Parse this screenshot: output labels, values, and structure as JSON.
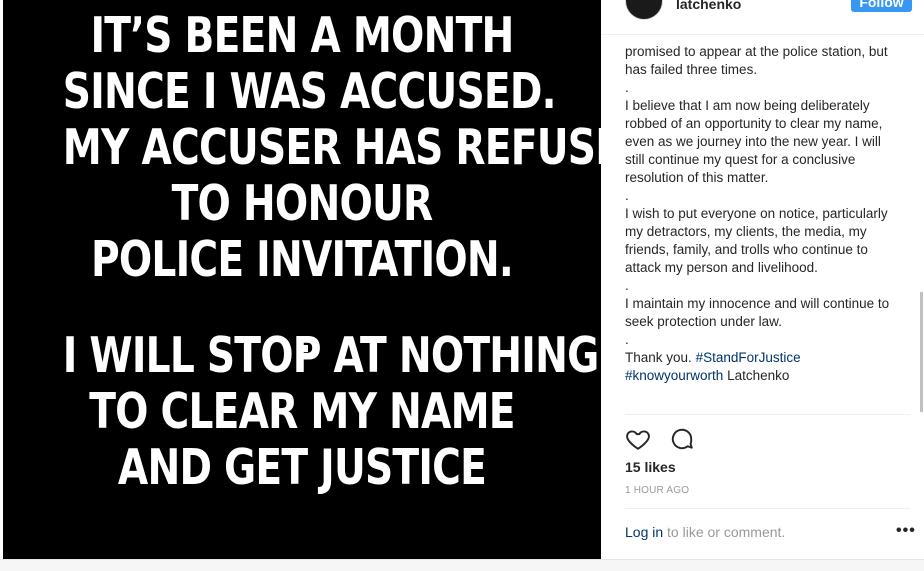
{
  "post": {
    "image_lines_top": [
      "IT’S BEEN A MONTH",
      "SINCE I WAS ACCUSED.",
      "MY ACCUSER HAS REFUSED",
      "TO HONOUR",
      "POLICE INVITATION."
    ],
    "image_dot": ".",
    "image_lines_bottom": [
      "I WILL STOP AT NOTHING",
      "TO CLEAR MY NAME",
      "AND GET JUSTICE"
    ]
  },
  "header": {
    "username": "latchenko",
    "follow_label": "Follow"
  },
  "caption": {
    "p1": "promised to appear at the police station, but has failed three times.",
    "sep1": ".",
    "p2": "I believe that I am now being deliberately robbed of an opportunity to clear my name, even as we journey into the new year. I will still continue my quest for a conclusive resolution of this matter.",
    "sep2": ".",
    "p3": "I wish to put everyone on notice, particularly my detractors, my clients, the media, my friends, family, and trolls who continue to attack my person and livelihood.",
    "sep3": ".",
    "p4": "I maintain my innocence and will continue to seek protection under law.",
    "sep4": ".",
    "p5_text": "Thank you.",
    "hashtag1": "#StandForJustice",
    "hashtag2": "#knowyourworth",
    "p5_tail": "Latchenko"
  },
  "stats": {
    "likes": "15 likes",
    "time": "1 HOUR AGO"
  },
  "footer": {
    "login_label": "Log in",
    "login_suffix": "to like or comment.",
    "more_label": "•••"
  },
  "icons": {
    "like": "heart-icon",
    "comment": "comment-icon",
    "more": "more-options-icon"
  }
}
